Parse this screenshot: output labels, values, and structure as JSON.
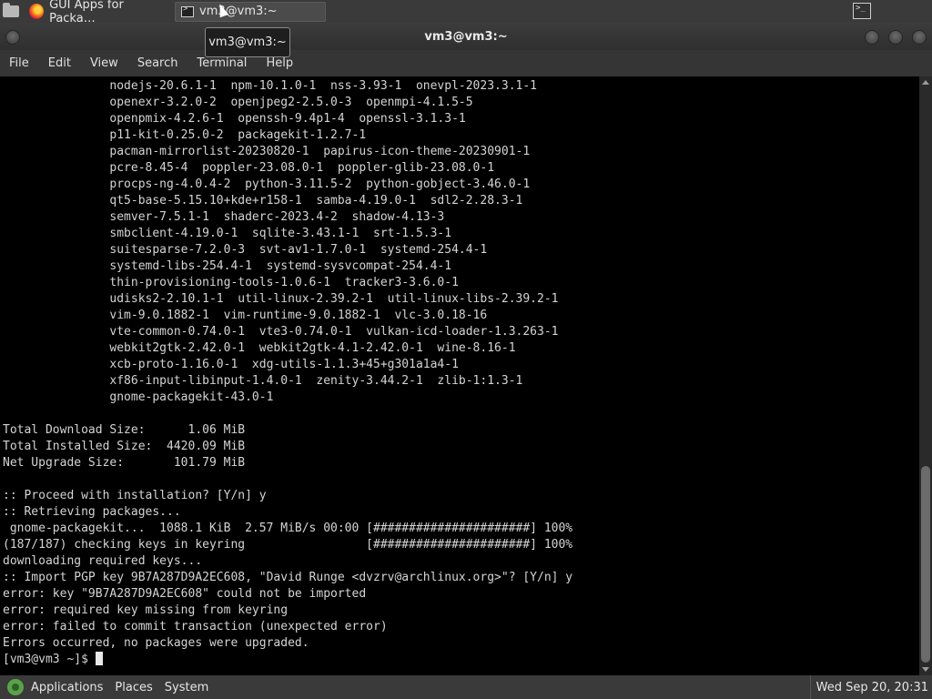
{
  "taskbar": {
    "tasks": [
      {
        "label": "GUI Apps for Packa…",
        "icon": "firefox-icon"
      },
      {
        "label": "vm3@vm3:~",
        "icon": "terminal-icon"
      }
    ]
  },
  "window": {
    "title": "vm3@vm3:~",
    "tooltip": "vm3@vm3:~"
  },
  "menubar": {
    "items": [
      "File",
      "Edit",
      "View",
      "Search",
      "Terminal",
      "Help"
    ]
  },
  "terminal": {
    "lines": [
      "               nodejs-20.6.1-1  npm-10.1.0-1  nss-3.93-1  onevpl-2023.3.1-1",
      "               openexr-3.2.0-2  openjpeg2-2.5.0-3  openmpi-4.1.5-5",
      "               openpmix-4.2.6-1  openssh-9.4p1-4  openssl-3.1.3-1",
      "               p11-kit-0.25.0-2  packagekit-1.2.7-1",
      "               pacman-mirrorlist-20230820-1  papirus-icon-theme-20230901-1",
      "               pcre-8.45-4  poppler-23.08.0-1  poppler-glib-23.08.0-1",
      "               procps-ng-4.0.4-2  python-3.11.5-2  python-gobject-3.46.0-1",
      "               qt5-base-5.15.10+kde+r158-1  samba-4.19.0-1  sdl2-2.28.3-1",
      "               semver-7.5.1-1  shaderc-2023.4-2  shadow-4.13-3",
      "               smbclient-4.19.0-1  sqlite-3.43.1-1  srt-1.5.3-1",
      "               suitesparse-7.2.0-3  svt-av1-1.7.0-1  systemd-254.4-1",
      "               systemd-libs-254.4-1  systemd-sysvcompat-254.4-1",
      "               thin-provisioning-tools-1.0.6-1  tracker3-3.6.0-1",
      "               udisks2-2.10.1-1  util-linux-2.39.2-1  util-linux-libs-2.39.2-1",
      "               vim-9.0.1882-1  vim-runtime-9.0.1882-1  vlc-3.0.18-16",
      "               vte-common-0.74.0-1  vte3-0.74.0-1  vulkan-icd-loader-1.3.263-1",
      "               webkit2gtk-2.42.0-1  webkit2gtk-4.1-2.42.0-1  wine-8.16-1",
      "               xcb-proto-1.16.0-1  xdg-utils-1.1.3+45+g301a1a4-1",
      "               xf86-input-libinput-1.4.0-1  zenity-3.44.2-1  zlib-1:1.3-1",
      "               gnome-packagekit-43.0-1",
      "",
      "Total Download Size:      1.06 MiB",
      "Total Installed Size:  4420.09 MiB",
      "Net Upgrade Size:       101.79 MiB",
      "",
      ":: Proceed with installation? [Y/n] y",
      ":: Retrieving packages...",
      " gnome-packagekit...  1088.1 KiB  2.57 MiB/s 00:00 [######################] 100%",
      "(187/187) checking keys in keyring                 [######################] 100%",
      "downloading required keys...",
      ":: Import PGP key 9B7A287D9A2EC608, \"David Runge <dvzrv@archlinux.org>\"? [Y/n] y",
      "error: key \"9B7A287D9A2EC608\" could not be imported",
      "error: required key missing from keyring",
      "error: failed to commit transaction (unexpected error)",
      "Errors occurred, no packages were upgraded."
    ],
    "prompt": "[vm3@vm3 ~]$ "
  },
  "bottom_panel": {
    "applications": "Applications",
    "places": "Places",
    "system": "System",
    "clock": "Wed Sep 20, 20:31"
  }
}
